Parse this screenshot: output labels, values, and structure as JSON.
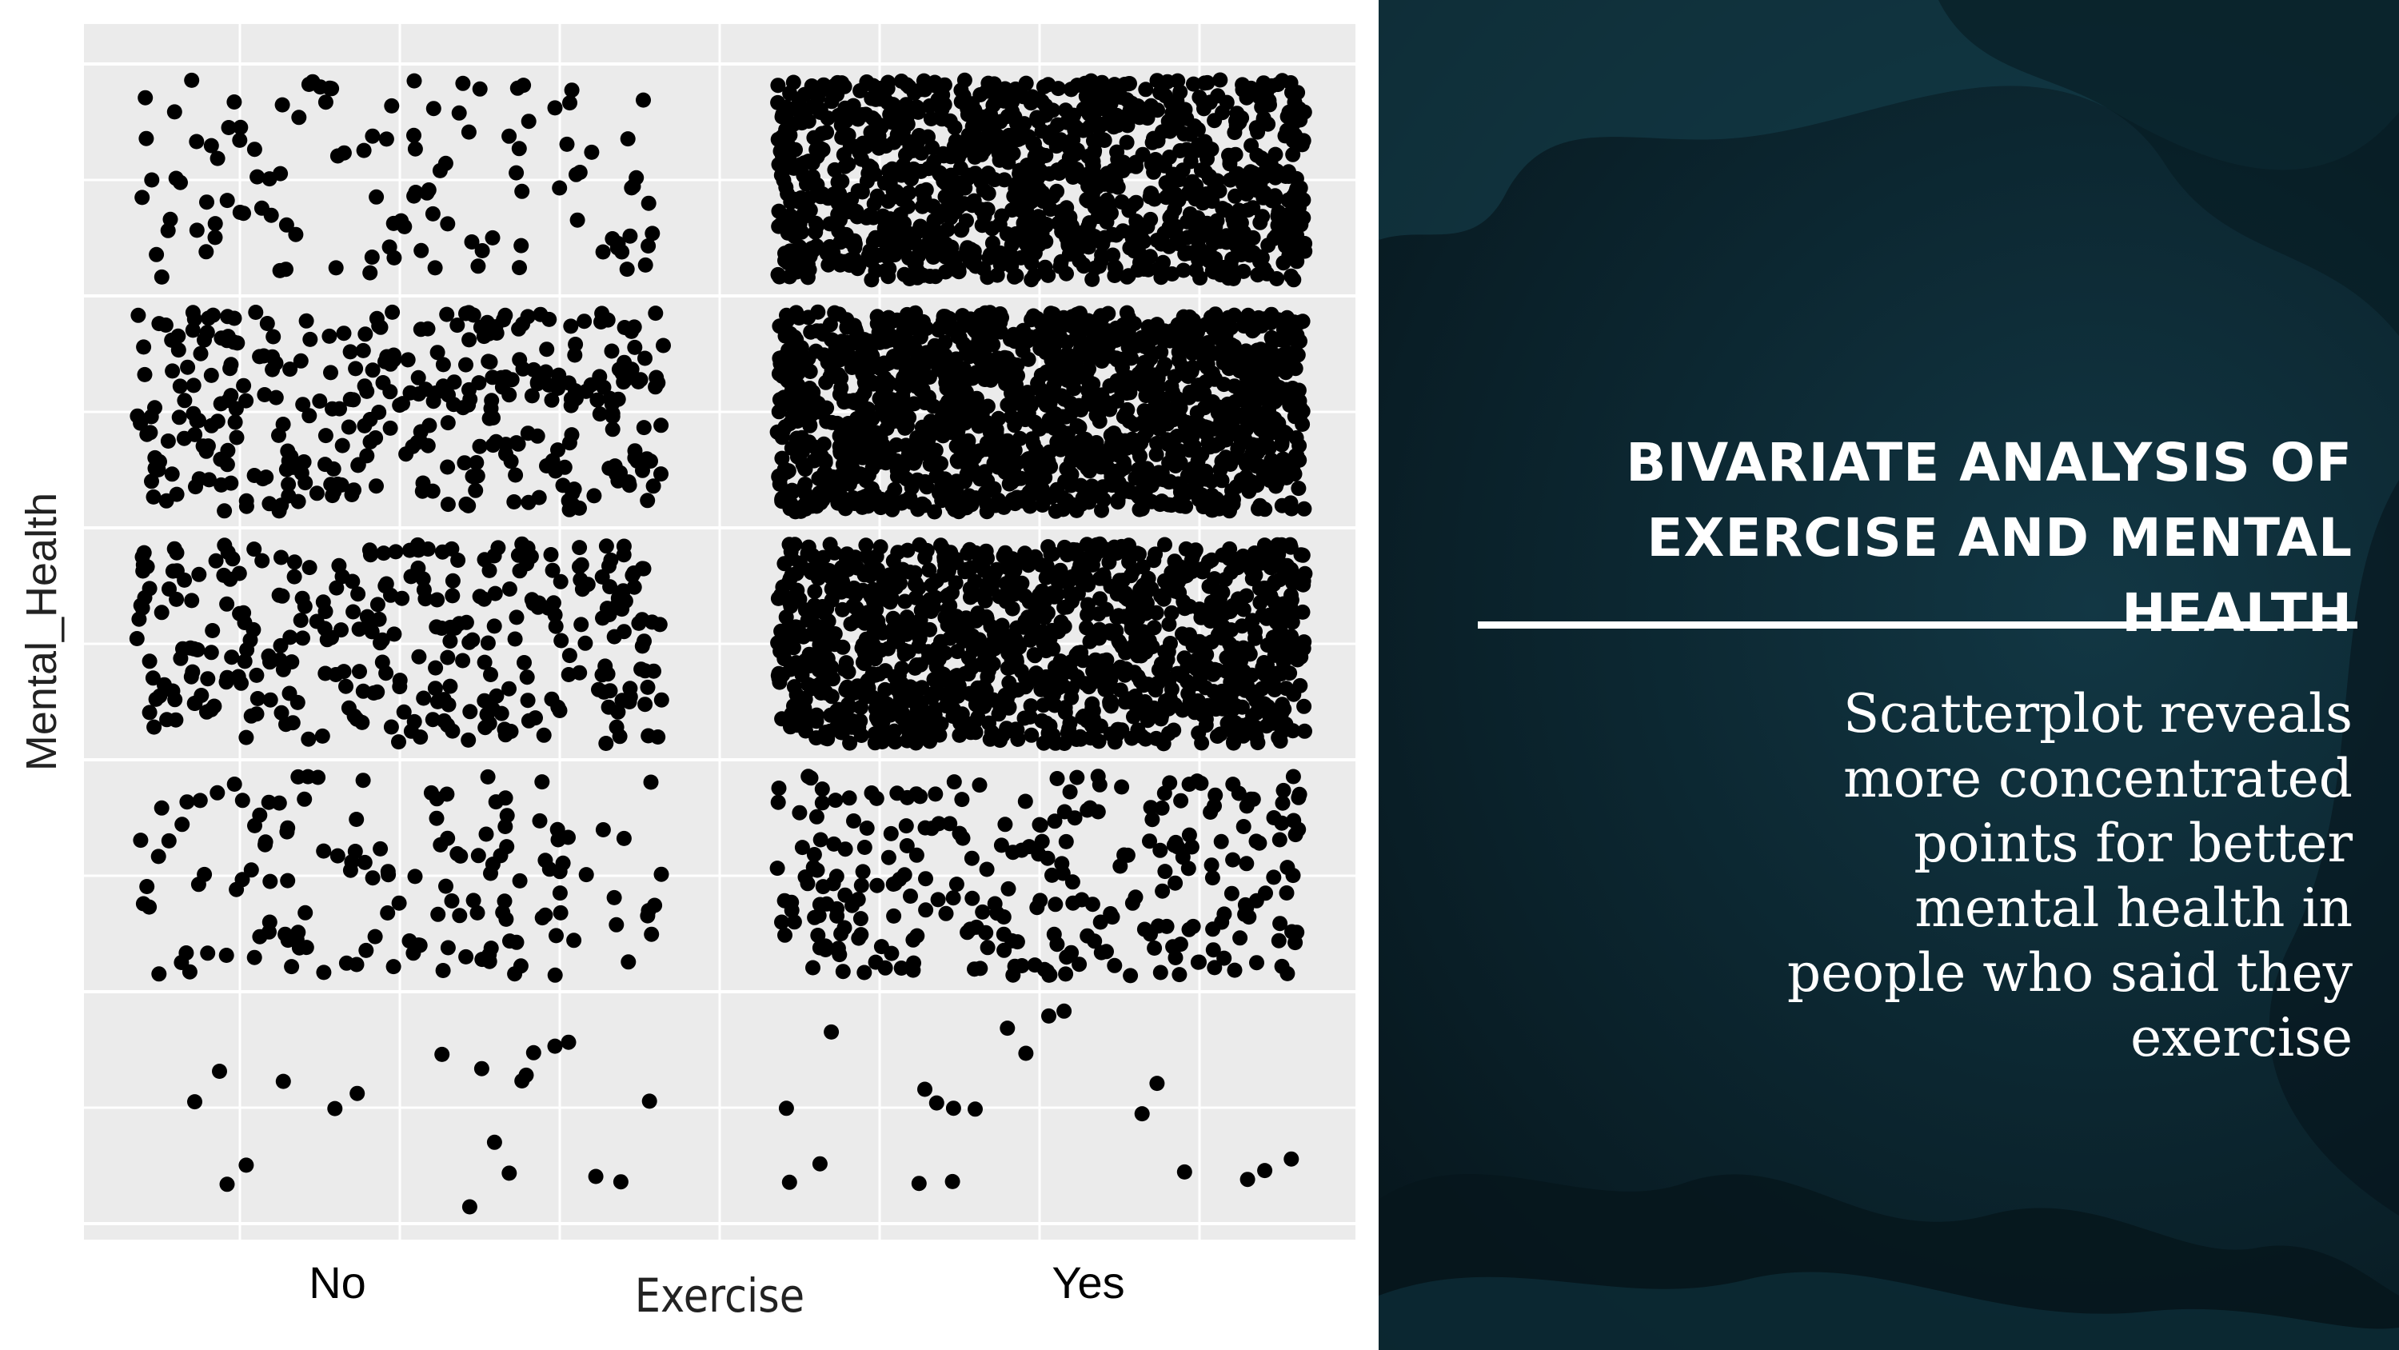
{
  "chart_data": {
    "type": "scatter",
    "xlabel": "Exercise",
    "ylabel": "Mental_Health",
    "categories": [
      "No",
      "Yes"
    ],
    "jitter": true,
    "grid": true,
    "legend": "none",
    "point_color": "#000000",
    "panel_background": "#ebebeb",
    "series": [
      {
        "category": "No",
        "level": 1,
        "approx_points": 55
      },
      {
        "category": "No",
        "level": 2,
        "approx_points": 420
      },
      {
        "category": "No",
        "level": 3,
        "approx_points": 900
      },
      {
        "category": "No",
        "level": 4,
        "approx_points": 1000
      },
      {
        "category": "No",
        "level": 5,
        "approx_points": 340
      },
      {
        "category": "Yes",
        "level": 1,
        "approx_points": 45
      },
      {
        "category": "Yes",
        "level": 2,
        "approx_points": 800
      },
      {
        "category": "Yes",
        "level": 3,
        "approx_points": 3400
      },
      {
        "category": "Yes",
        "level": 4,
        "approx_points": 4200
      },
      {
        "category": "Yes",
        "level": 5,
        "approx_points": 3300
      }
    ]
  },
  "slide": {
    "title": "Bivariate Analysis of Exercise and Mental Health",
    "body": "Scatterplot reveals more concentrated points for better mental health in people who said they exercise"
  },
  "colors": {
    "panel_dark": "#0c2731",
    "text": "#ffffff"
  }
}
